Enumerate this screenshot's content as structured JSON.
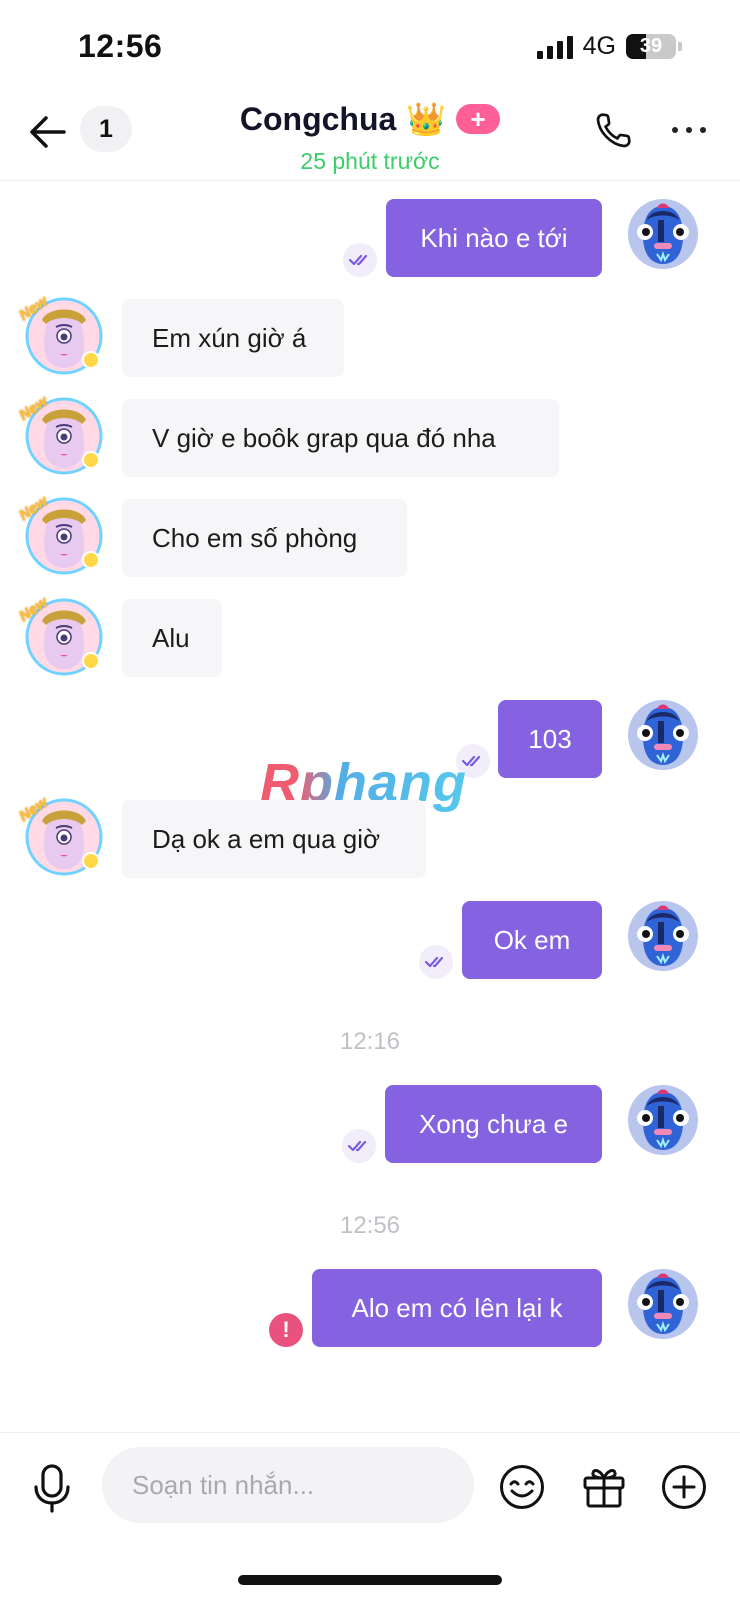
{
  "status_bar": {
    "time": "12:56",
    "network": "4G",
    "battery": "39",
    "battery_level": 0.39
  },
  "header": {
    "unread_count": "1",
    "contact_name": "Congchua",
    "crown_emoji": "👑",
    "add_badge": "+",
    "last_seen": "25 phút trước"
  },
  "messages": [
    {
      "direction": "out",
      "text": "Khi nào e tới"
    },
    {
      "direction": "in",
      "text": "Em xún giờ á"
    },
    {
      "direction": "in",
      "text": "V giờ e boôk grap qua đó nha"
    },
    {
      "direction": "in",
      "text": "Cho em số phòng"
    },
    {
      "direction": "in",
      "text": "Alu"
    },
    {
      "direction": "out",
      "text": "103"
    },
    {
      "direction": "in",
      "text": "Dạ ok a em qua giờ"
    },
    {
      "direction": "out",
      "text": "Ok em"
    },
    {
      "direction": "out",
      "text": "Xong chưa e"
    },
    {
      "direction": "out",
      "text": "Alo em có lên lại k"
    }
  ],
  "time_separators": [
    "12:16",
    "12:56"
  ],
  "error_mark": "!",
  "avatar_badge": "New",
  "watermark": "Rphang",
  "composer": {
    "placeholder": "Soạn tin nhắn...",
    "value": ""
  },
  "colors": {
    "outgoing_bubble": "#8462e0",
    "incoming_bubble": "#f6f6f8",
    "online_status": "#3ccc6b",
    "add_badge": "#ff5f97",
    "error": "#e8527d"
  },
  "icons": {
    "back": "arrow-left-icon",
    "call": "phone-icon",
    "more": "more-dots-icon",
    "read": "double-check-icon",
    "mic": "microphone-icon",
    "sticker": "smiley-icon",
    "gift": "gift-icon",
    "plus": "plus-circle-icon"
  }
}
